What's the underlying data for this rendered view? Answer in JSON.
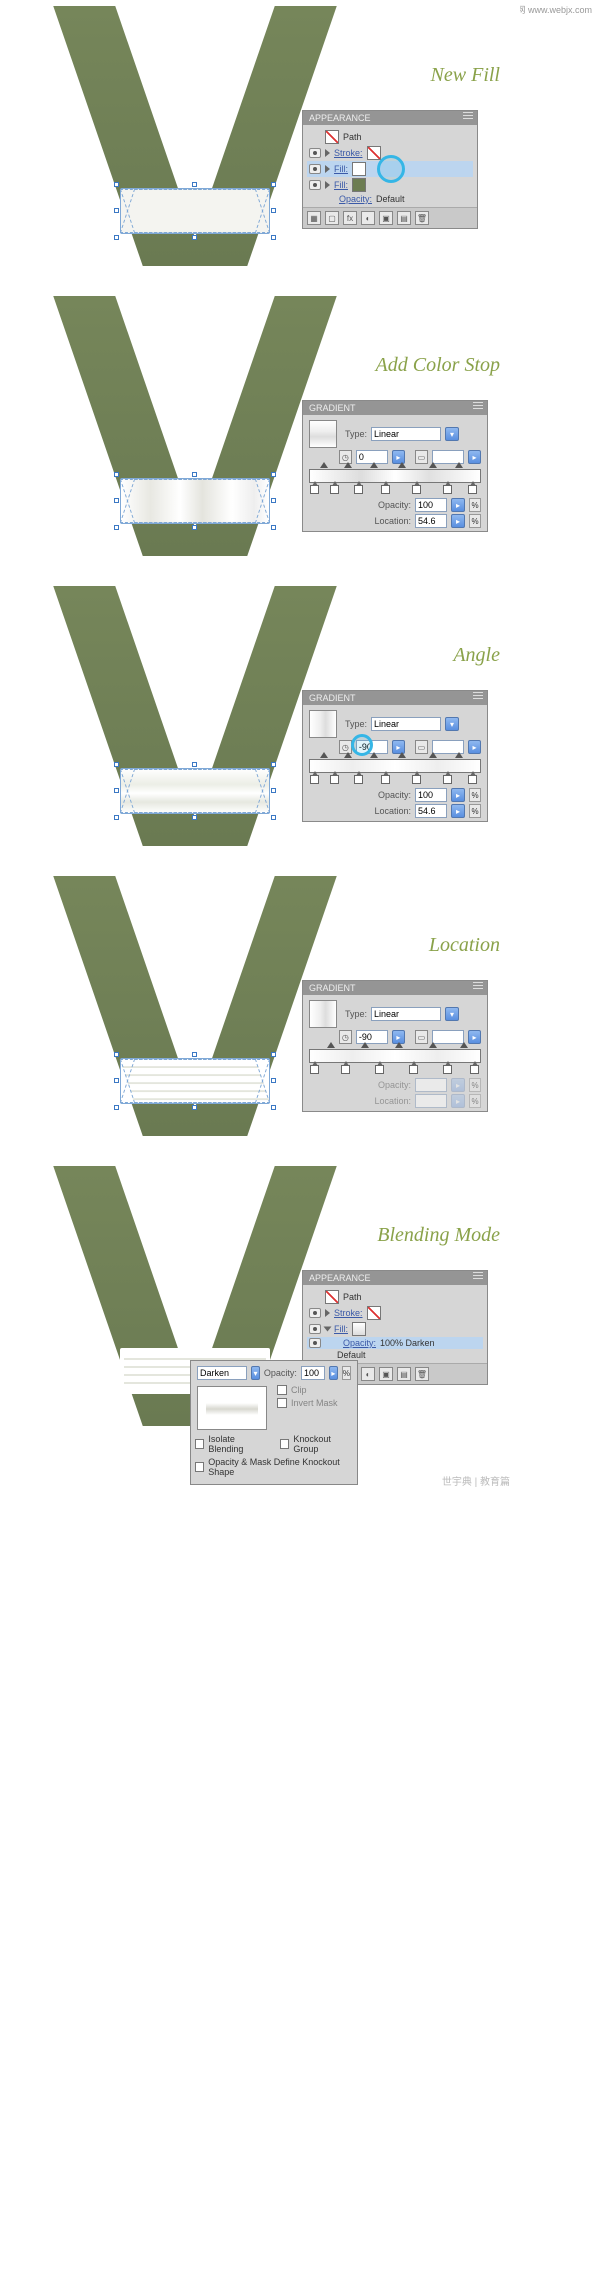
{
  "watermark_top": "网页教学网\nwww.webjx.com",
  "watermark_bottom": "世宇典 | 教育篇",
  "steps": [
    {
      "title": "New Fill"
    },
    {
      "title": "Add Color Stop"
    },
    {
      "title": "Angle"
    },
    {
      "title": "Location"
    },
    {
      "title": "Blending Mode"
    }
  ],
  "appearance": {
    "panel_title": "APPEARANCE",
    "path_label": "Path",
    "stroke_label": "Stroke:",
    "fill_label": "Fill:",
    "opacity_label": "Opacity:",
    "opacity_default": "Default",
    "opacity_value": "100% Darken",
    "footer_fx": "fx"
  },
  "gradient": {
    "panel_title": "GRADIENT",
    "type_label": "Type:",
    "type_value": "Linear",
    "angle_0": "0",
    "angle_neg90": "-90",
    "opacity_label": "Opacity:",
    "opacity_value": "100",
    "location_label": "Location:",
    "location_value": "54.6"
  },
  "transparency": {
    "mode": "Darken",
    "opacity_label": "Opacity:",
    "opacity_value": "100",
    "clip": "Clip",
    "invert_mask": "Invert Mask",
    "isolate": "Isolate Blending",
    "knockout": "Knockout Group",
    "mask_define": "Opacity & Mask Define Knockout Shape"
  },
  "chart_data": null
}
